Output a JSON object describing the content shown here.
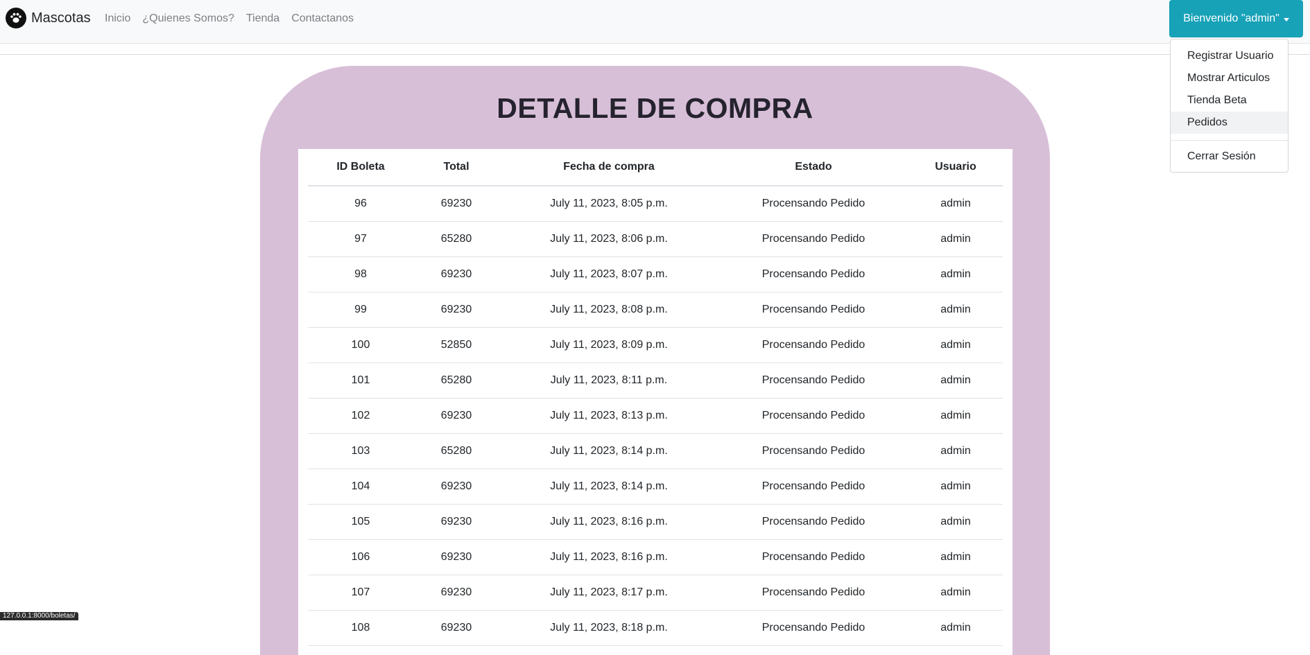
{
  "navbar": {
    "brand": "Mascotas",
    "links": [
      "Inicio",
      "¿Quienes Somos?",
      "Tienda",
      "Contactanos"
    ],
    "user_button": "Bienvenido \"admin\""
  },
  "dropdown": {
    "items": [
      "Registrar Usuario",
      "Mostrar Articulos",
      "Tienda Beta",
      "Pedidos"
    ],
    "logout": "Cerrar Sesión"
  },
  "main": {
    "title": "DETALLE DE COMPRA",
    "columns": [
      "ID Boleta",
      "Total",
      "Fecha de compra",
      "Estado",
      "Usuario"
    ],
    "rows": [
      [
        "96",
        "69230",
        "July 11, 2023, 8:05 p.m.",
        "Procensando Pedido",
        "admin"
      ],
      [
        "97",
        "65280",
        "July 11, 2023, 8:06 p.m.",
        "Procensando Pedido",
        "admin"
      ],
      [
        "98",
        "69230",
        "July 11, 2023, 8:07 p.m.",
        "Procensando Pedido",
        "admin"
      ],
      [
        "99",
        "69230",
        "July 11, 2023, 8:08 p.m.",
        "Procensando Pedido",
        "admin"
      ],
      [
        "100",
        "52850",
        "July 11, 2023, 8:09 p.m.",
        "Procensando Pedido",
        "admin"
      ],
      [
        "101",
        "65280",
        "July 11, 2023, 8:11 p.m.",
        "Procensando Pedido",
        "admin"
      ],
      [
        "102",
        "69230",
        "July 11, 2023, 8:13 p.m.",
        "Procensando Pedido",
        "admin"
      ],
      [
        "103",
        "65280",
        "July 11, 2023, 8:14 p.m.",
        "Procensando Pedido",
        "admin"
      ],
      [
        "104",
        "69230",
        "July 11, 2023, 8:14 p.m.",
        "Procensando Pedido",
        "admin"
      ],
      [
        "105",
        "69230",
        "July 11, 2023, 8:16 p.m.",
        "Procensando Pedido",
        "admin"
      ],
      [
        "106",
        "69230",
        "July 11, 2023, 8:16 p.m.",
        "Procensando Pedido",
        "admin"
      ],
      [
        "107",
        "69230",
        "July 11, 2023, 8:17 p.m.",
        "Procensando Pedido",
        "admin"
      ],
      [
        "108",
        "69230",
        "July 11, 2023, 8:18 p.m.",
        "Procensando Pedido",
        "admin"
      ]
    ]
  },
  "status_bar_url": "127.0.0.1:8000/boletas/",
  "colors": {
    "accent": "#17a2b8",
    "card": "#d8bfd8",
    "navbar": "#f8f9fa"
  }
}
